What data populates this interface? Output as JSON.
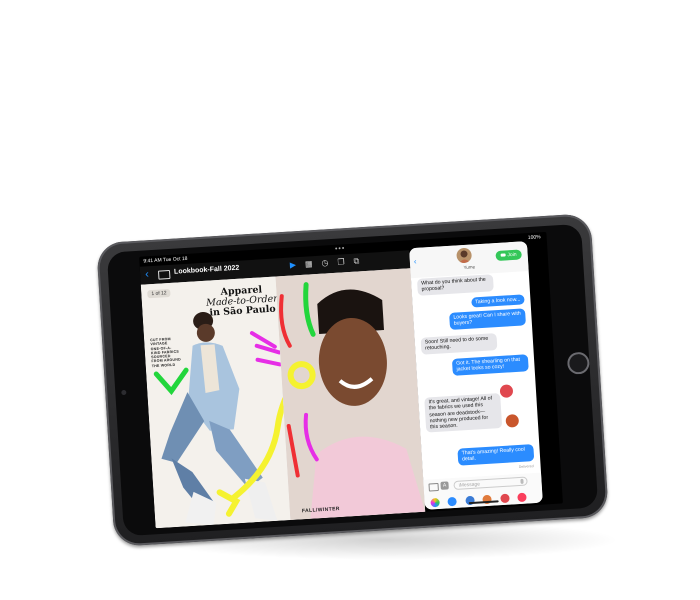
{
  "status_bar": {
    "time": "9:41 AM  Tue Oct 18",
    "right": "100%"
  },
  "toolbar": {
    "title": "Lookbook-Fall 2022"
  },
  "page": {
    "badge": "1 of 12",
    "headline": [
      "Apparel",
      "Made-to-Order",
      "in São Paulo"
    ],
    "blurb": [
      "CUT FROM",
      "VINTAGE",
      "ONE-OF-A-",
      "KIND FABRICS",
      "SOURCED",
      "FROM AROUND",
      "THE WORLD"
    ],
    "footer": "FALL/WINTER"
  },
  "messages": {
    "contact": "Yume",
    "join_label": "Join",
    "thread": [
      {
        "dir": "in",
        "text": "What do you think about the proposal?"
      },
      {
        "dir": "out",
        "text": "Taking a look now..."
      },
      {
        "dir": "out",
        "text": "Looks great! Can I share with buyers?"
      },
      {
        "dir": "in",
        "text": "Soon! Still need to do some retouching."
      },
      {
        "dir": "out",
        "text": "Got it. The shearling on that jacket looks so cozy!"
      },
      {
        "dir": "in",
        "text": "It's great, and vintage! All of the fabrics we used this season are deadstock—nothing new produced for this season."
      },
      {
        "dir": "out",
        "text": "That's amazing! Really cool detail."
      }
    ],
    "delivered": "Delivered",
    "input_placeholder": "iMessage",
    "appstore_glyph": "A"
  },
  "colors": {
    "accent": "#2b8cff",
    "join": "#34c759",
    "marker_yellow": "#f5f230",
    "marker_green": "#22d63c",
    "marker_magenta": "#e62ee6",
    "marker_red": "#ef2f34"
  },
  "icons": [
    "back-chevron-icon",
    "sidebar-icon",
    "play-icon",
    "grid-icon",
    "clock-icon",
    "layers-icon",
    "share-icon",
    "camera-icon",
    "appstore-icon",
    "mic-icon",
    "video-icon"
  ]
}
